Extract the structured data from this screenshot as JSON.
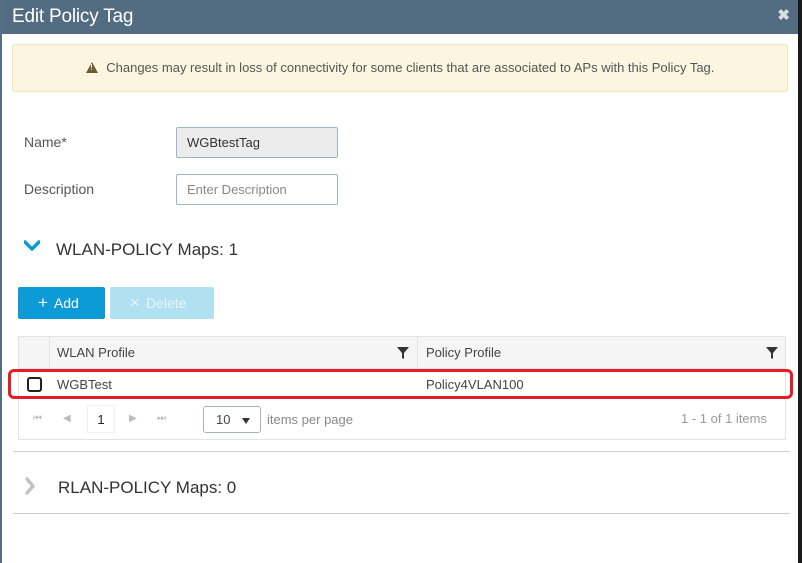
{
  "modal": {
    "title": "Edit Policy Tag",
    "close_icon": "close-icon"
  },
  "alert": {
    "icon": "warning-icon",
    "message": "Changes may result in loss of connectivity for some clients that are associated to APs with this Policy Tag."
  },
  "form": {
    "name_label": "Name*",
    "name_value": "WGBtestTag",
    "description_label": "Description",
    "description_placeholder": "Enter Description",
    "description_value": ""
  },
  "wlan_section": {
    "title": "WLAN-POLICY Maps: 1",
    "expanded": true,
    "add_label": "Add",
    "delete_label": "Delete",
    "delete_enabled": false,
    "columns": [
      "WLAN Profile",
      "Policy Profile"
    ],
    "rows": [
      {
        "selected": false,
        "wlan_profile": "WGBTest",
        "policy_profile": "Policy4VLAN100",
        "highlighted": true
      }
    ],
    "pager": {
      "current_page": "1",
      "page_size": "10",
      "page_size_label": "items per page",
      "count_text": "1 - 1 of 1 items"
    }
  },
  "rlan_section": {
    "title": "RLAN-POLICY Maps: 0",
    "expanded": false
  },
  "colors": {
    "header_bg": "#536c82",
    "primary_button": "#0d9bd7",
    "disabled_button": "#b1e0f3",
    "alert_bg": "#fcf6e1",
    "highlight_annotation": "#e31e24"
  }
}
